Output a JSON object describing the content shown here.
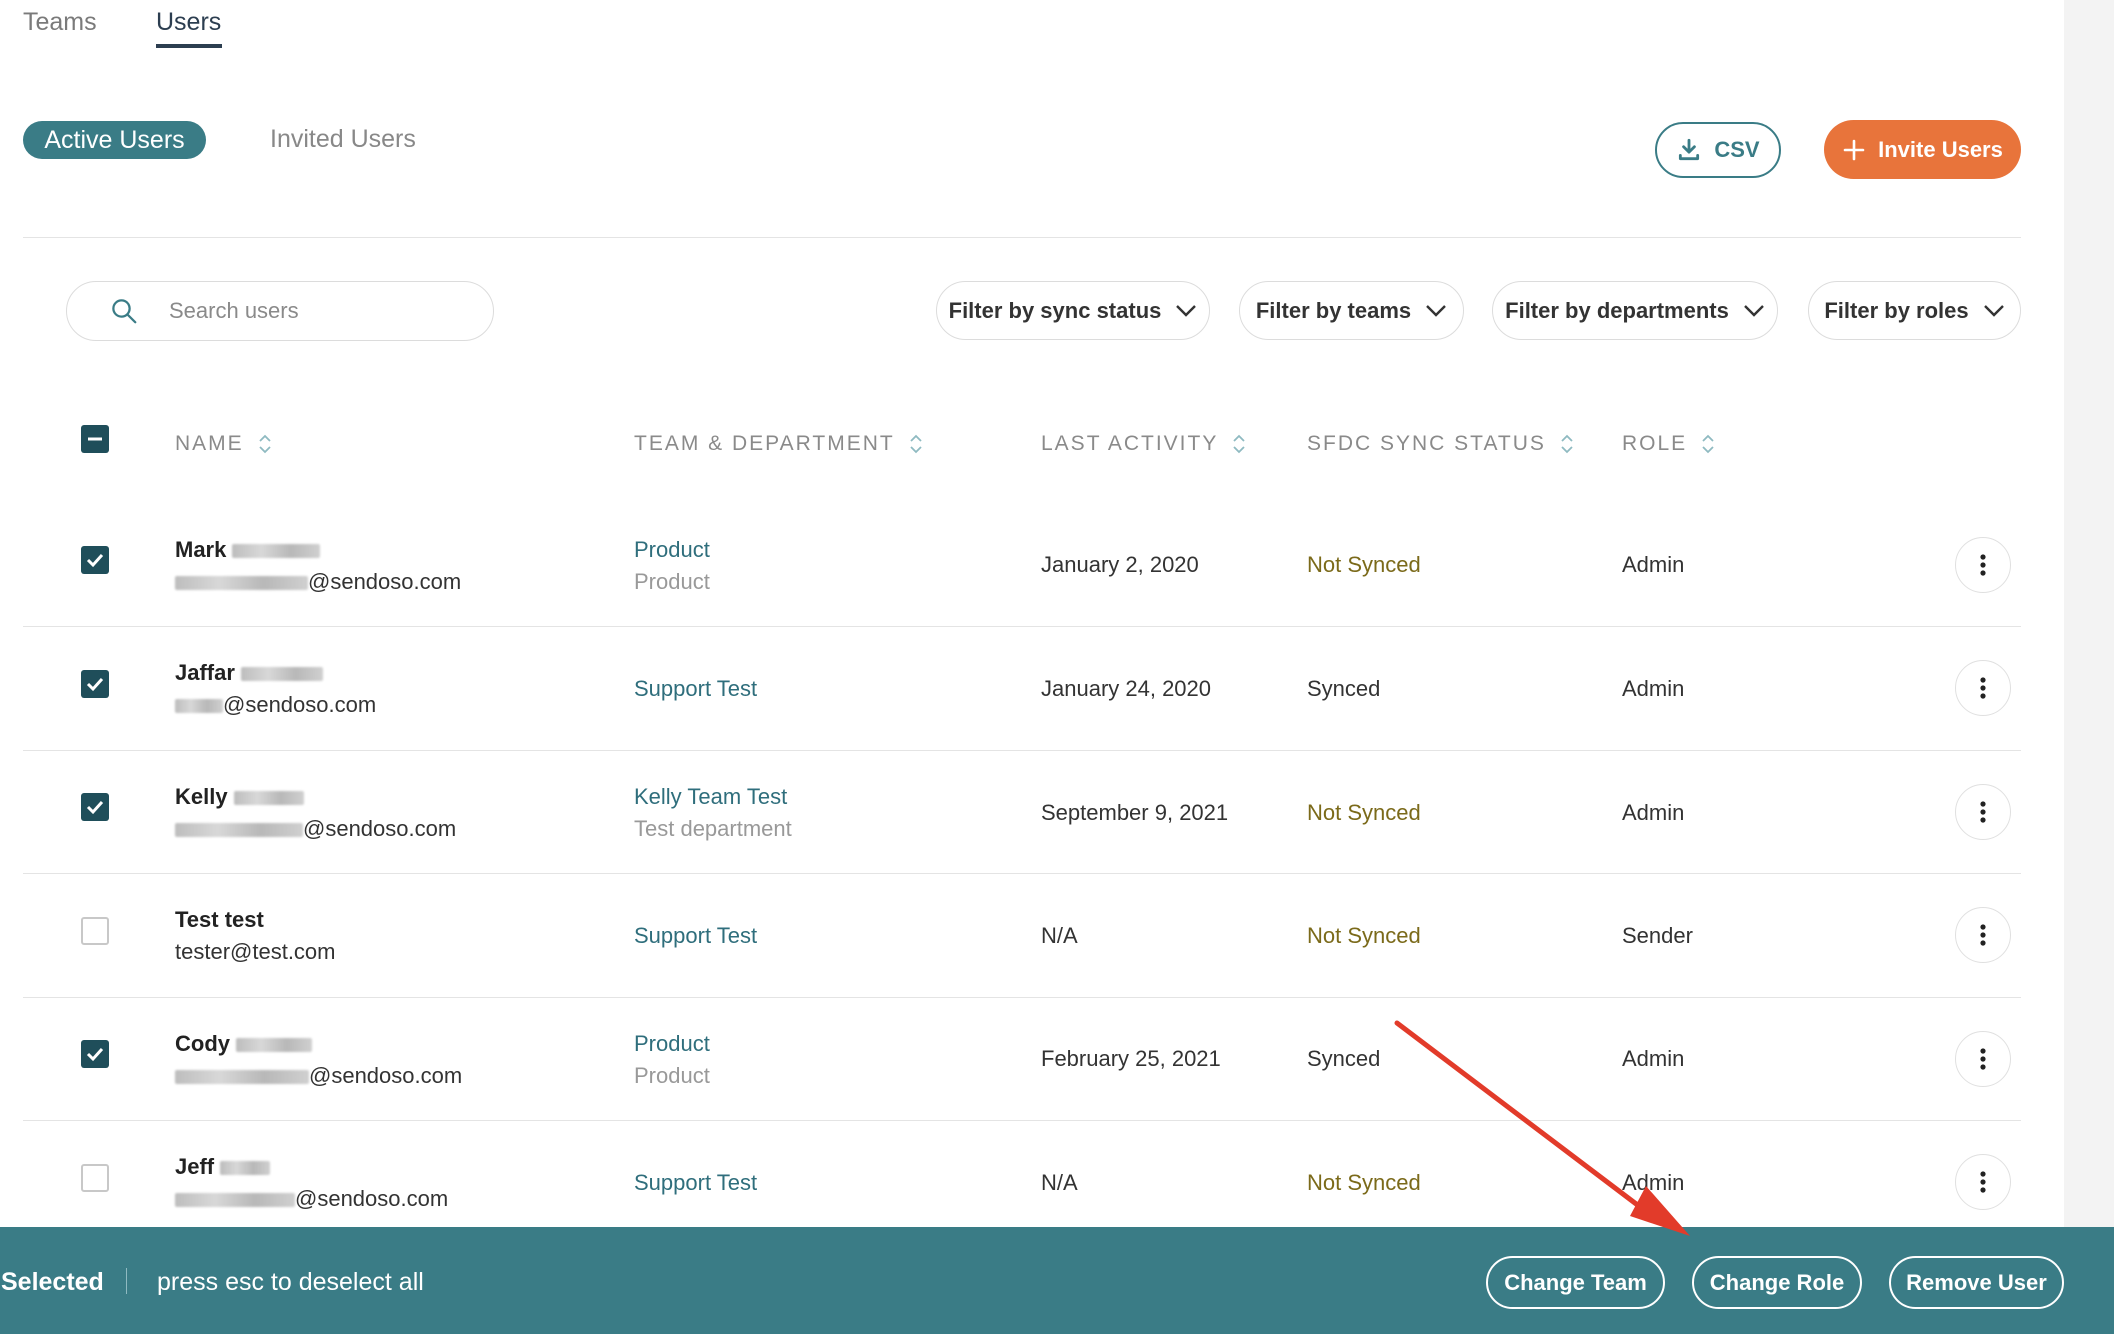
{
  "top_tabs": [
    {
      "label": "Teams",
      "active": false
    },
    {
      "label": "Users",
      "active": true
    }
  ],
  "segments": {
    "active_label": "Active Users",
    "inactive_label": "Invited Users"
  },
  "actions": {
    "csv_label": "CSV",
    "invite_label": "Invite Users",
    "accent": "#e8743b",
    "primary": "#3a7c86"
  },
  "search": {
    "placeholder": "Search users"
  },
  "filters": [
    {
      "label": "Filter by sync status"
    },
    {
      "label": "Filter by teams"
    },
    {
      "label": "Filter by departments"
    },
    {
      "label": "Filter by roles"
    }
  ],
  "table": {
    "headers": [
      "NAME",
      "TEAM & DEPARTMENT",
      "LAST ACTIVITY",
      "SFDC SYNC STATUS",
      "ROLE"
    ],
    "rows": [
      {
        "first_name": "Mark",
        "email_suffix": "@sendoso.com",
        "team": "Product",
        "department": "Product",
        "last_activity": "January 2, 2020",
        "sync": "Not Synced",
        "role": "Admin",
        "checked": true
      },
      {
        "first_name": "Jaffar",
        "email_suffix": "@sendoso.com",
        "team": "Support Test",
        "department": "",
        "last_activity": "January 24, 2020",
        "sync": "Synced",
        "role": "Admin",
        "checked": true
      },
      {
        "first_name": "Kelly",
        "email_suffix": "@sendoso.com",
        "team": "Kelly Team Test",
        "department": "Test department",
        "last_activity": "September 9, 2021",
        "sync": "Not Synced",
        "role": "Admin",
        "checked": true
      },
      {
        "first_name": "Test test",
        "email_suffix": "tester@test.com",
        "team": "Support Test",
        "department": "",
        "last_activity": "N/A",
        "sync": "Not Synced",
        "role": "Sender",
        "checked": false
      },
      {
        "first_name": "Cody",
        "email_suffix": "@sendoso.com",
        "team": "Product",
        "department": "Product",
        "last_activity": "February 25, 2021",
        "sync": "Synced",
        "role": "Admin",
        "checked": true
      },
      {
        "first_name": "Jeff",
        "email_suffix": "@sendoso.com",
        "team": "Support Test",
        "department": "",
        "last_activity": "N/A",
        "sync": "Not Synced",
        "role": "Admin",
        "checked": false
      }
    ]
  },
  "bottom_bar": {
    "selected_label": "Selected",
    "hint": "press esc to deselect all",
    "buttons": [
      "Change Team",
      "Change Role",
      "Remove User"
    ]
  }
}
